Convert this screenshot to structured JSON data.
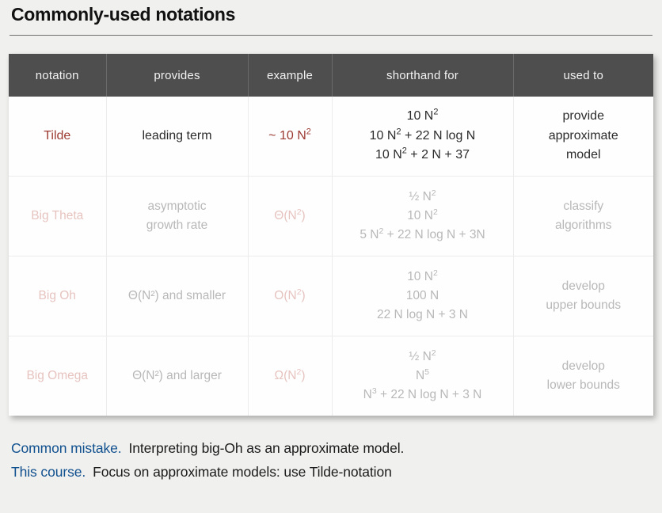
{
  "slide": {
    "title": "Commonly-used notations"
  },
  "table": {
    "headers": [
      "notation",
      "provides",
      "example",
      "shorthand for",
      "used to"
    ],
    "rows": [
      {
        "notation": "Tilde",
        "provides": [
          "leading term"
        ],
        "example_prefix": "~ 10 N",
        "example_sup": "2",
        "shorthand": [
          {
            "pre": "10 N",
            "sup": "2",
            "post": ""
          },
          {
            "pre": "10 N",
            "sup": "2",
            "post": " + 22 N log N"
          },
          {
            "pre": "10 N",
            "sup": "2",
            "post": " + 2 N + 37"
          }
        ],
        "used_to": [
          "provide",
          "approximate",
          "model"
        ]
      },
      {
        "notation": "Big Theta",
        "provides": [
          "asymptotic",
          "growth rate"
        ],
        "example_prefix": "Θ(N",
        "example_sup": "2",
        "example_suffix": ")",
        "shorthand": [
          {
            "pre": "½ N",
            "sup": "2",
            "post": ""
          },
          {
            "pre": "10 N",
            "sup": "2",
            "post": ""
          },
          {
            "pre": "5 N",
            "sup": "2",
            "post": " + 22 N log N + 3N"
          }
        ],
        "used_to": [
          "classify",
          "algorithms"
        ]
      },
      {
        "notation": "Big Oh",
        "provides": [
          "Θ(N²) and smaller"
        ],
        "example_prefix": "O(N",
        "example_sup": "2",
        "example_suffix": ")",
        "shorthand": [
          {
            "pre": "10 N",
            "sup": "2",
            "post": ""
          },
          {
            "pre": "100 N",
            "sup": "",
            "post": ""
          },
          {
            "pre": "22 N log N + 3 N",
            "sup": "",
            "post": ""
          }
        ],
        "used_to": [
          "develop",
          "upper bounds"
        ]
      },
      {
        "notation": "Big Omega",
        "provides": [
          "Θ(N²) and larger"
        ],
        "example_prefix": "Ω(N",
        "example_sup": "2",
        "example_suffix": ")",
        "shorthand": [
          {
            "pre": "½ N",
            "sup": "2",
            "post": ""
          },
          {
            "pre": "N",
            "sup": "5",
            "post": ""
          },
          {
            "pre": "N",
            "sup": "3",
            "post": " + 22 N log N + 3 N"
          }
        ],
        "used_to": [
          "develop",
          "lower bounds"
        ]
      }
    ]
  },
  "footnotes": [
    {
      "lead": "Common mistake.",
      "text": "Interpreting big-Oh as an approximate model."
    },
    {
      "lead": "This course.",
      "text": "Focus on approximate models: use Tilde-notation"
    }
  ],
  "colors": {
    "accent_red": "#9c3a32",
    "faded_red": "#e6c3bf",
    "accent_blue": "#10508f",
    "header_bg": "#4e4e4e",
    "page_bg": "#f0f0ee"
  }
}
